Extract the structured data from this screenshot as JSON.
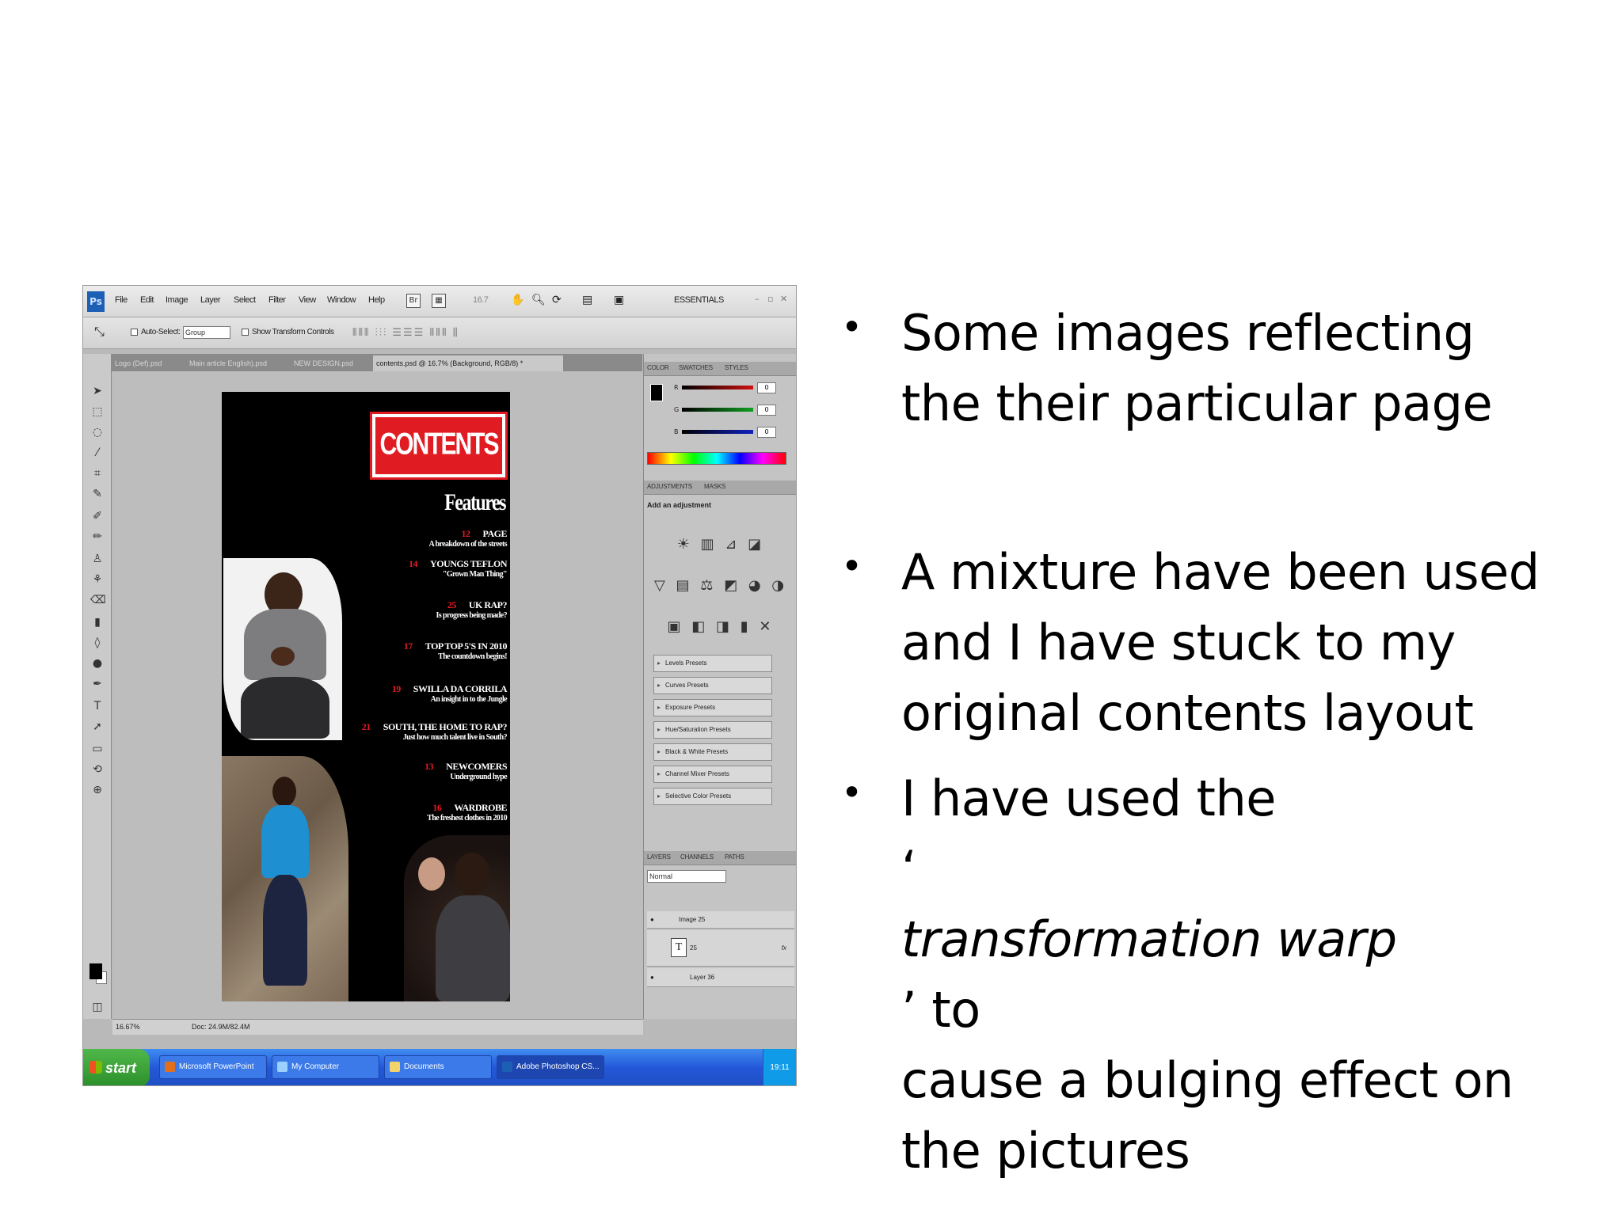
{
  "photoshop": {
    "app_logo": "Ps",
    "menu": [
      "File",
      "Edit",
      "Image",
      "Layer",
      "Select",
      "Filter",
      "View",
      "Window",
      "Help"
    ],
    "zoom_menu": "16.7",
    "workspace": "ESSENTIALS",
    "options": {
      "auto_select_label": "Auto-Select:",
      "auto_select_value": "Group",
      "show_transform_label": "Show Transform Controls"
    },
    "tabs": [
      "Logo (Def).psd",
      "Main article English).psd",
      "NEW DESIGN.psd",
      "contents.psd @ 16.7% (Background, RGB/8) *"
    ],
    "document": {
      "contents_label": "CONTENTS",
      "features_label": "Features",
      "entries": [
        {
          "num": "12",
          "title": "PAGE",
          "sub": "A breakdown of the streets"
        },
        {
          "num": "14",
          "title": "YOUNGS TEFLON",
          "sub": "\"Grown Man Thing\""
        },
        {
          "num": "25",
          "title": "UK RAP?",
          "sub": "Is progress being made?"
        },
        {
          "num": "17",
          "title": "TOP TOP 5'S IN 2010",
          "sub": "The countdown begins!"
        },
        {
          "num": "19",
          "title": "SWILLA DA CORRILA",
          "sub": "An insight in to the Jungle"
        },
        {
          "num": "21",
          "title": "SOUTH, THE HOME TO RAP?",
          "sub": "Just how much talent live in South?"
        },
        {
          "num": "13",
          "title": "NEWCOMERS",
          "sub": "Underground hype"
        },
        {
          "num": "16",
          "title": "WARDROBE",
          "sub": "The freshest clothes in 2010"
        }
      ]
    },
    "panels": {
      "color_tabs": [
        "COLOR",
        "SWATCHES",
        "STYLES"
      ],
      "sliders": [
        {
          "label": "R",
          "value": "0",
          "color": "#d01010"
        },
        {
          "label": "G",
          "value": "0",
          "color": "#10a020"
        },
        {
          "label": "B",
          "value": "0",
          "color": "#1020c0"
        }
      ],
      "adjust_tabs": [
        "ADJUSTMENTS",
        "MASKS"
      ],
      "add_adjustment": "Add an adjustment",
      "adjust_icon_rows": [
        "☀ ▥ ⊿ ◪",
        "▽ ▤ ⚖ ◩ ◕ ◑",
        "▣ ◧ ◨ ▮ ✕"
      ],
      "presets": [
        "Levels Presets",
        "Curves Presets",
        "Exposure Presets",
        "Hue/Saturation Presets",
        "Black & White Presets",
        "Channel Mixer Presets",
        "Selective Color Presets"
      ],
      "layer_tabs": [
        "LAYERS",
        "CHANNELS",
        "PATHS"
      ],
      "blend_mode": "Normal",
      "layers": [
        {
          "name": "Image 25",
          "icon": "eye-icon"
        },
        {
          "name": "25",
          "icon": "text-layer-icon"
        },
        {
          "name": "Layer 36",
          "icon": "eye-icon"
        }
      ]
    },
    "status": {
      "zoom": "16.67%",
      "doc_size": "Doc: 24.9M/82.4M"
    },
    "taskbar": {
      "start": "start",
      "items": [
        {
          "label": "Microsoft PowerPoint",
          "icon_color": "#e0701c"
        },
        {
          "label": "My Computer",
          "icon_color": "#9bd0ff"
        },
        {
          "label": "Documents",
          "icon_color": "#f3d36b"
        },
        {
          "label": "Adobe Photoshop CS...",
          "icon_color": "#1c5fb5"
        }
      ],
      "clock": "19:11"
    }
  },
  "bullets": [
    {
      "lines": [
        "Some images reflecting",
        "the their particular page"
      ]
    },
    {
      "lines": [
        "A mixture have been used",
        "and I have stuck to my",
        "original contents layout"
      ]
    },
    {
      "line1": "I have used the",
      "line2_open": "‘",
      "line2_em": "transformation warp",
      "line2_close": "’ to",
      "line3": "cause a bulging effect on",
      "line4": "the pictures"
    }
  ]
}
